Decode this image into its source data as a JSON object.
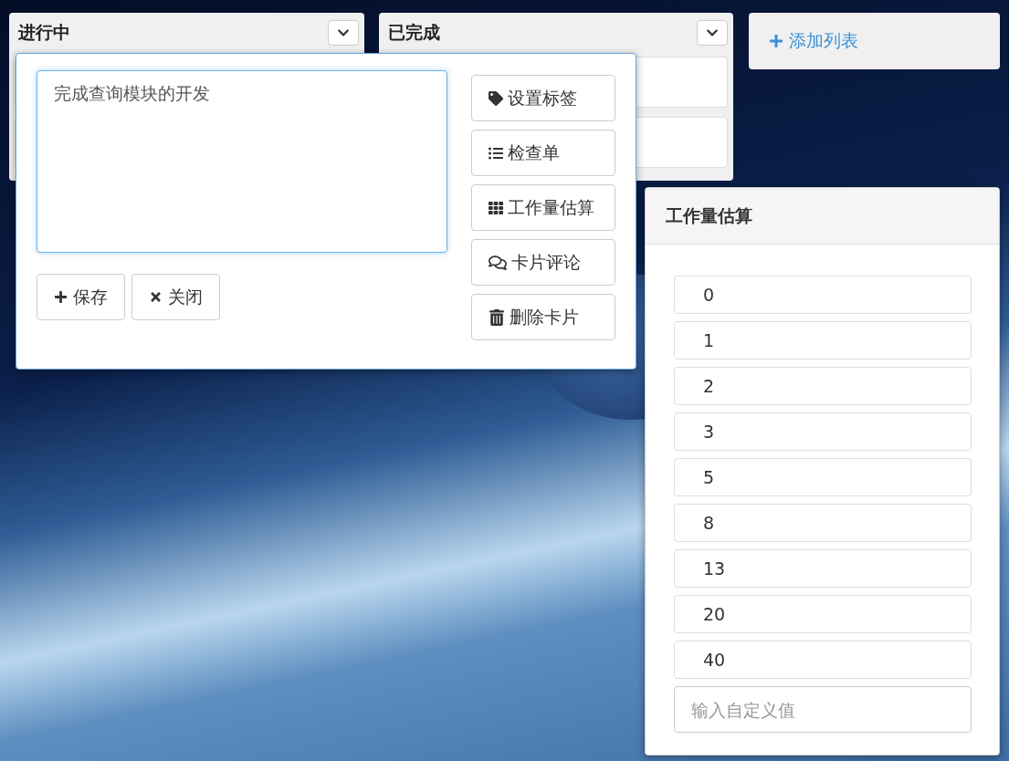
{
  "lists": [
    {
      "title": "进行中"
    },
    {
      "title": "已完成"
    }
  ],
  "add_list": {
    "label": "添加列表"
  },
  "card_editor": {
    "text": "完成查询模块的开发",
    "buttons": [
      {
        "kind": "save",
        "label": "保存"
      },
      {
        "kind": "close",
        "label": "关闭"
      }
    ],
    "actions": [
      {
        "kind": "tag",
        "label": "设置标签"
      },
      {
        "kind": "checklist",
        "label": "检查单"
      },
      {
        "kind": "estimate",
        "label": "工作量估算"
      },
      {
        "kind": "comment",
        "label": "卡片评论"
      },
      {
        "kind": "delete",
        "label": "删除卡片"
      }
    ]
  },
  "estimate_popup": {
    "title": "工作量估算",
    "options": [
      "0",
      "1",
      "2",
      "3",
      "5",
      "8",
      "13",
      "20",
      "40"
    ],
    "custom": {
      "placeholder": "输入自定义值"
    }
  }
}
